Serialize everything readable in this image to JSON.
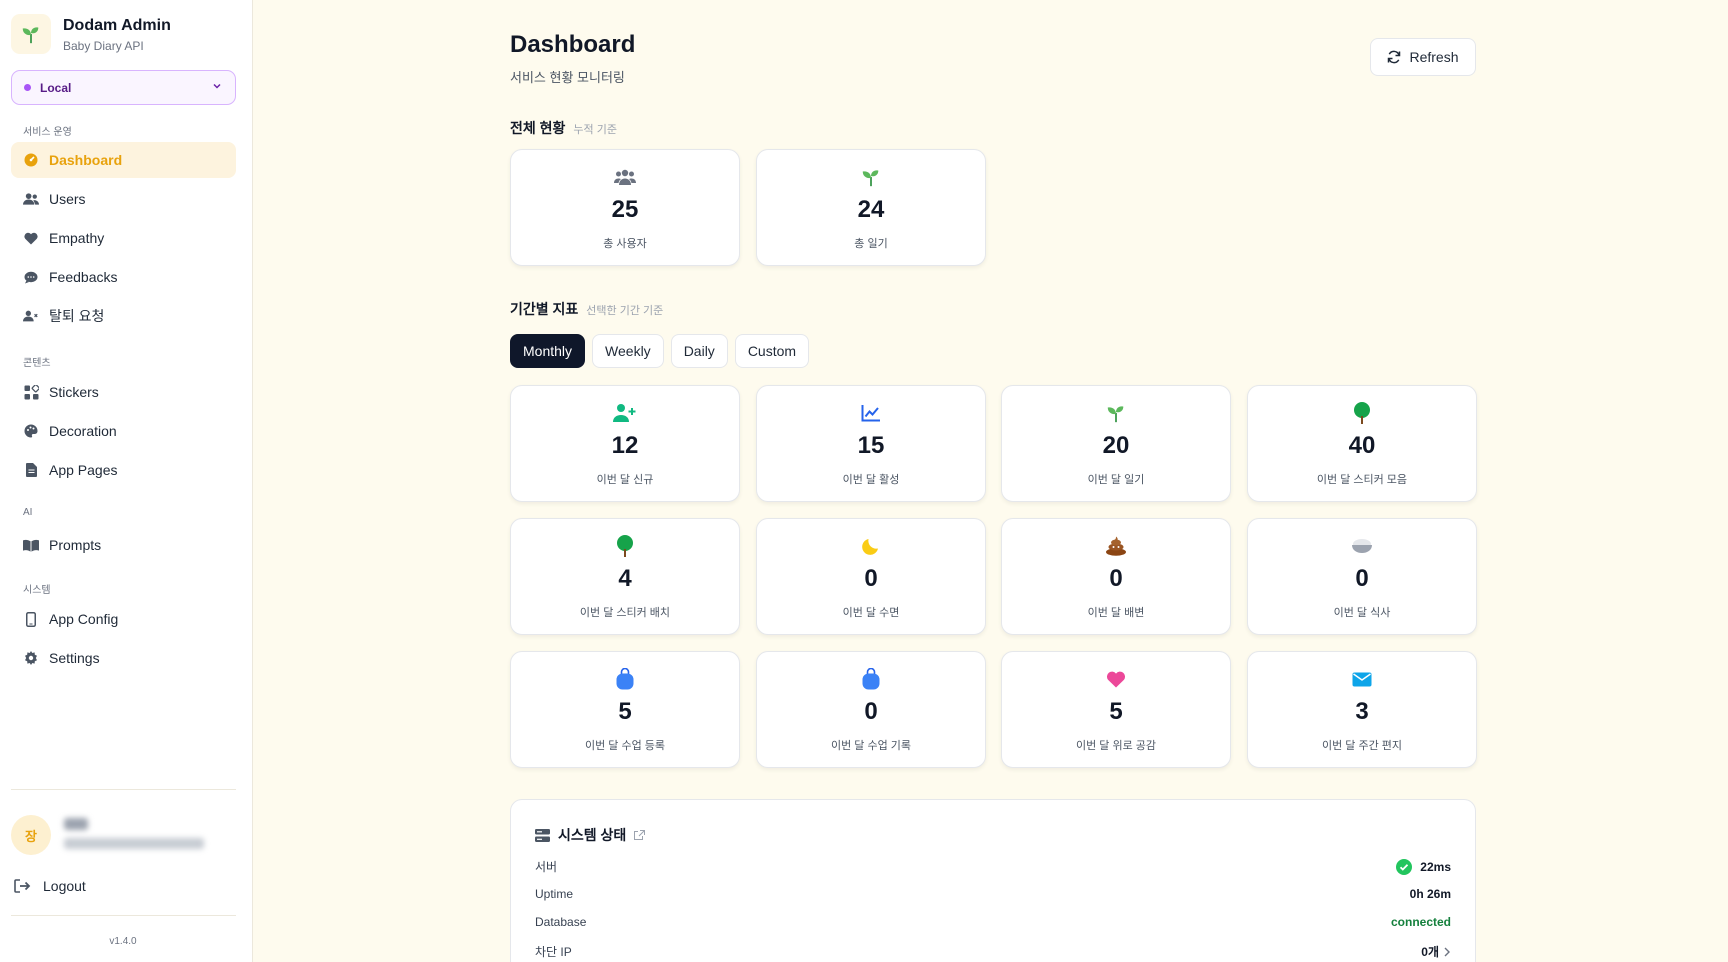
{
  "brand": {
    "title": "Dodam Admin",
    "subtitle": "Baby Diary API"
  },
  "env": {
    "selected": "Local"
  },
  "sidebar": {
    "sections": [
      "서비스 운영",
      "콘텐츠",
      "AI",
      "시스템"
    ],
    "items": [
      {
        "label": "Dashboard",
        "icon": "dashboard-icon"
      },
      {
        "label": "Users",
        "icon": "users-icon"
      },
      {
        "label": "Empathy",
        "icon": "heart-icon"
      },
      {
        "label": "Feedbacks",
        "icon": "chat-icon"
      },
      {
        "label": "탈퇴 요청",
        "icon": "user-remove-icon"
      },
      {
        "label": "Stickers",
        "icon": "sticker-icon"
      },
      {
        "label": "Decoration",
        "icon": "palette-icon"
      },
      {
        "label": "App Pages",
        "icon": "file-icon"
      },
      {
        "label": "Prompts",
        "icon": "book-icon"
      },
      {
        "label": "App Config",
        "icon": "phone-icon"
      },
      {
        "label": "Settings",
        "icon": "gear-icon"
      }
    ]
  },
  "user": {
    "avatar_initial": "장"
  },
  "logout_label": "Logout",
  "version": "v1.4.0",
  "header": {
    "title": "Dashboard",
    "subtitle": "서비스 현황 모니터링",
    "refresh_label": "Refresh"
  },
  "overall": {
    "title": "전체 현황",
    "hint": "누적 기준",
    "cards": [
      {
        "value": "25",
        "label": "총 사용자",
        "icon": "users-icon"
      },
      {
        "value": "24",
        "label": "총 일기",
        "icon": "sprout-icon"
      }
    ]
  },
  "period": {
    "title": "기간별 지표",
    "hint": "선택한 기간 기준",
    "tabs": [
      "Monthly",
      "Weekly",
      "Daily",
      "Custom"
    ],
    "active_tab": "Monthly",
    "cards": [
      {
        "value": "12",
        "label": "이번 달 신규",
        "icon": "user-plus-icon"
      },
      {
        "value": "15",
        "label": "이번 달 활성",
        "icon": "chart-line-icon"
      },
      {
        "value": "20",
        "label": "이번 달 일기",
        "icon": "sprout-icon"
      },
      {
        "value": "40",
        "label": "이번 달 스티커 모음",
        "icon": "tree-icon"
      },
      {
        "value": "4",
        "label": "이번 달 스티커 배치",
        "icon": "tree-icon"
      },
      {
        "value": "0",
        "label": "이번 달 수면",
        "icon": "moon-icon"
      },
      {
        "value": "0",
        "label": "이번 달 배변",
        "icon": "poop-icon"
      },
      {
        "value": "0",
        "label": "이번 달 식사",
        "icon": "bowl-icon"
      },
      {
        "value": "5",
        "label": "이번 달 수업 등록",
        "icon": "bag-icon"
      },
      {
        "value": "0",
        "label": "이번 달 수업 기록",
        "icon": "bag-icon"
      },
      {
        "value": "5",
        "label": "이번 달 위로 공감",
        "icon": "heart-icon"
      },
      {
        "value": "3",
        "label": "이번 달 주간 편지",
        "icon": "envelope-icon"
      }
    ]
  },
  "system": {
    "title": "시스템 상태",
    "rows": [
      {
        "label": "서버",
        "value": "22ms"
      },
      {
        "label": "Uptime",
        "value": "0h 26m"
      },
      {
        "label": "Database",
        "value": "connected"
      },
      {
        "label": "차단 IP",
        "value": "0개"
      }
    ]
  },
  "colors": {
    "accent": "#e8a20d",
    "env": "#a855f7",
    "success": "#22c55e",
    "bg": "#fefbee"
  }
}
